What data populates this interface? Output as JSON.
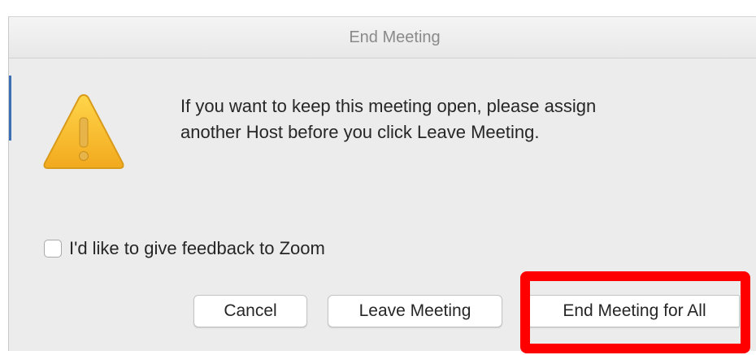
{
  "dialog": {
    "title": "End Meeting",
    "message_line1": "If you want to keep this meeting open, please assign",
    "message_line2": "another Host before you click Leave Meeting.",
    "icon": "warning-icon",
    "feedback": {
      "label": "I'd like to give feedback to Zoom",
      "checked": false
    },
    "buttons": {
      "cancel": "Cancel",
      "leave": "Leave Meeting",
      "end_all": "End Meeting for All"
    }
  },
  "annotation": {
    "highlight_color": "#ff0000",
    "target": "End Meeting for All"
  }
}
